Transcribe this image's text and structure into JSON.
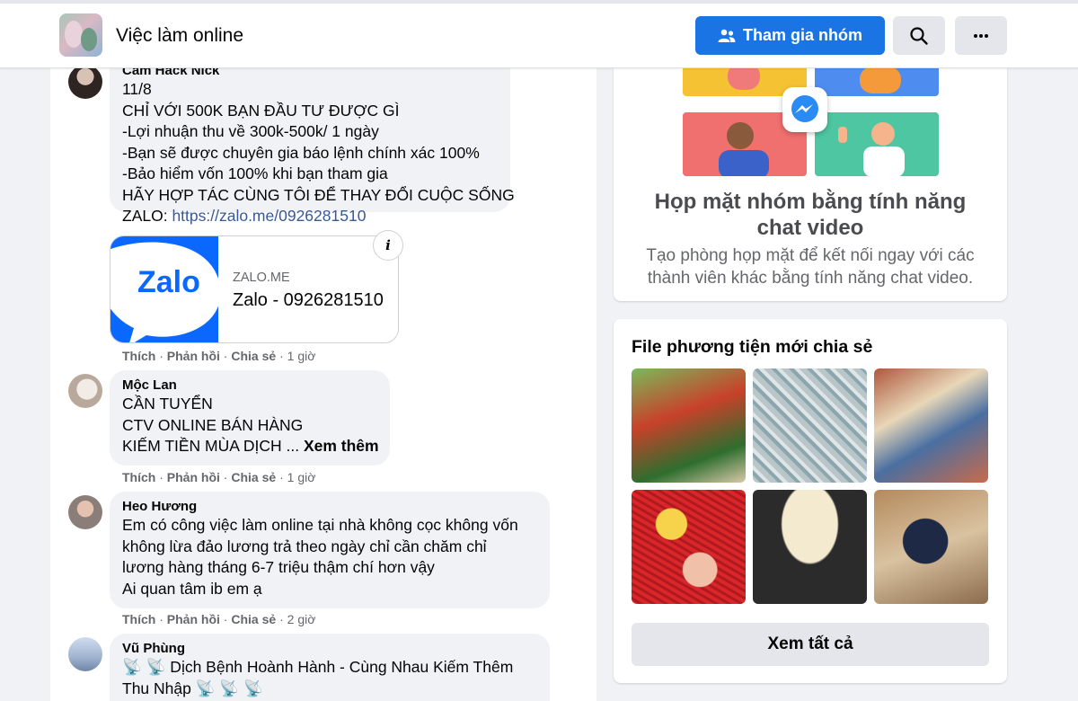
{
  "header": {
    "group_name": "Việc làm online",
    "join_label": "Tham gia nhóm",
    "icons": [
      "people-icon",
      "search-icon",
      "more-icon"
    ]
  },
  "comments": [
    {
      "author": "Cam Hack Nick",
      "lines": [
        "11/8",
        "CHỈ VỚI 500K BẠN ĐẦU TƯ ĐƯỢC GÌ",
        "-Lợi nhuận thu về 300k-500k/ 1 ngày",
        "-Bạn sẽ được chuyên gia báo lệnh chính xác 100%",
        "-Bảo hiểm vốn 100% khi bạn tham gia",
        "HÃY HỢP TÁC CÙNG TÔI ĐỂ THAY ĐỔI CUỘC SỐNG"
      ],
      "zalo_prefix": "ZALO: ",
      "zalo_link": "https://zalo.me/0926281510",
      "card": {
        "logo_text": "Zalo",
        "domain": "ZALO.ME",
        "title": "Zalo - 0926281510",
        "info": "i"
      },
      "like": "Thích",
      "reply": "Phản hồi",
      "share": "Chia sẻ",
      "time": "1 giờ"
    },
    {
      "author": "Mộc Lan",
      "lines": [
        "CẦN TUYỂN",
        "CTV ONLINE BÁN HÀNG",
        "KIẾM TIỀN MÙA DỊCH ... "
      ],
      "see_more": "Xem thêm",
      "like": "Thích",
      "reply": "Phản hồi",
      "share": "Chia sẻ",
      "time": "1 giờ"
    },
    {
      "author": "Heo Hương",
      "lines": [
        "Em có công việc làm online tại nhà không cọc không vốn",
        "không lừa đảo lương trả theo ngày chỉ cần chăm chỉ",
        "lương hàng tháng 6-7 triệu thậm chí hơn vậy",
        "Ai quan tâm ib em ạ"
      ],
      "like": "Thích",
      "reply": "Phản hồi",
      "share": "Chia sẻ",
      "time": "2 giờ"
    },
    {
      "author": "Vũ Phùng",
      "lines": [
        "📡 📡 Dịch Bệnh Hoành Hành - Cùng Nhau Kiếm Thêm",
        "Thu Nhập 📡 📡 📡"
      ]
    }
  ],
  "sidebar": {
    "video_chat": {
      "title_line1": "Họp mặt nhóm bằng tính năng",
      "title_line2": "chat video",
      "desc_line1": "Tạo phòng họp mặt để kết nối ngay với các",
      "desc_line2": "thành viên khác bằng tính năng chat video."
    },
    "media": {
      "title": "File phương tiện mới chia sẻ",
      "see_all": "Xem tất cả",
      "thumbnail_count": 6
    }
  },
  "colors": {
    "brand": "#1b74e4",
    "link": "#385898",
    "zalo": "#0a68ff",
    "page_bg": "#f0f2f5"
  }
}
